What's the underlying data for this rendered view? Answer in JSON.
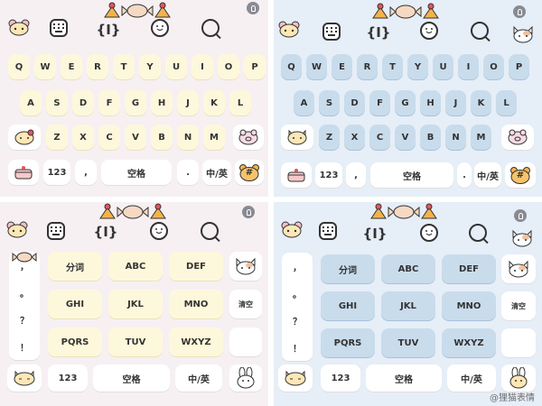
{
  "colors": {
    "pink_bg": "#f6f0f3",
    "blue_bg": "#e6eef7",
    "cream_key": "#fdf8dc",
    "sky_key": "#c9dcec",
    "white_key": "#ffffff",
    "text": "#333333"
  },
  "toolbar_icons": [
    "bear-face-icon",
    "keyboard-grid-icon",
    "sweets-icon",
    "text-cursor-icon",
    "smiley-icon",
    "search-q-icon",
    "user-avatar-icon"
  ],
  "qwerty": {
    "row1": [
      "Q",
      "W",
      "E",
      "R",
      "T",
      "Y",
      "U",
      "I",
      "O",
      "P"
    ],
    "row2": [
      "A",
      "S",
      "D",
      "F",
      "G",
      "H",
      "J",
      "K",
      "L"
    ],
    "row3": [
      "Z",
      "X",
      "C",
      "V",
      "B",
      "N",
      "M"
    ],
    "bottom": {
      "num_key": "123",
      "comma_key": ",",
      "space_key": "空格",
      "period_key": ".",
      "lang_key": "中/英",
      "hash_key": "#"
    }
  },
  "ninekey": {
    "punct": [
      "，",
      "。",
      "？",
      "！"
    ],
    "grid": [
      "分词",
      "ABC",
      "DEF",
      "GHI",
      "JKL",
      "MNO",
      "PQRS",
      "TUV",
      "WXYZ"
    ],
    "clear_key": "清空",
    "num_key": "123",
    "space_key": "空格",
    "lang_key": "中/英"
  },
  "watermark": "@狸猫表情"
}
